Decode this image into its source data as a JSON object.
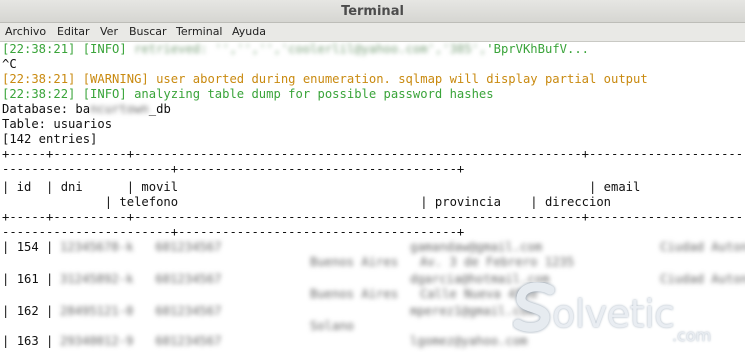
{
  "window": {
    "title": "Terminal"
  },
  "menu": [
    "Archivo",
    "Editar",
    "Ver",
    "Buscar",
    "Terminal",
    "Ayuda"
  ],
  "lines": {
    "l1_prefix": "[22:38:21] [INFO] ",
    "l1_blur": "retrieved: '','','','coolerlil@yahoo.com','385',",
    "l1_tail": "'BprVKhBufV...",
    "l2": "^C",
    "l3": "[22:38:21] [WARNING] user aborted during enumeration. sqlmap will display partial output",
    "l4": "[22:38:22] [INFO] analyzing table dump for possible password hashes",
    "l5_a": "Database: ba",
    "l5_blur": "ncurtown",
    "l5_b": "_db",
    "l6": "Table: usuarios",
    "l7": "[142 entries]"
  },
  "table": {
    "sep1": "+-----+----------+-------------------------------------------------------------+--------------------------------------------------------+--------",
    "sep2": "-----------------------+--------------------------------------+",
    "header1": "| id  | dni      | movil                                                        | email                                                   | ciudad",
    "header2": "              | telefono                                 | provincia    | direccion                                   |",
    "rows": [
      {
        "id": "154",
        "blur1": "12345678-k   601234567",
        "blur2": "gamandaw@gmail.com",
        "blur3": "Ciudad Autonoma",
        "blur4": "Buenos Aires",
        "blur5": "Av. 3 de Febrero 1235"
      },
      {
        "id": "161",
        "blur1": "31245892-k   601234567",
        "blur2": "dgarcia@hotmail.com",
        "blur3": "Ciudad Autonoma",
        "blur4": "Buenos Aires",
        "blur5": "Calle Nueva 4550"
      },
      {
        "id": "162",
        "blur1": "28495121-0   601234567",
        "blur2": "mperez1@gmail.com",
        "blur3": "Ciudad Autonoma",
        "blur4": "Solano",
        "blur5": "Av. Corrientes 3456"
      },
      {
        "id": "163",
        "blur1": "29340012-9   601234567",
        "blur2": "lgomez@yahoo.com",
        "blur3": "Ciudad Autonoma",
        "blur4": "Buenos Aires",
        "blur5": "Calle 25 de Mayo 1234"
      }
    ]
  },
  "logo": {
    "text": "olvetic",
    "suffix": ".com"
  }
}
